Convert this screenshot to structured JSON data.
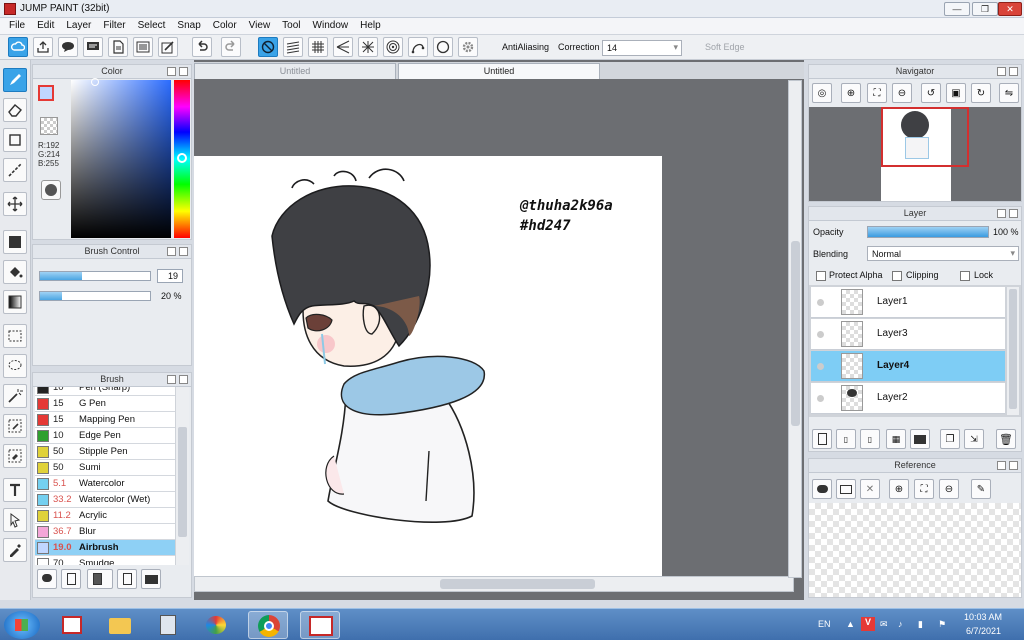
{
  "window": {
    "title": "JUMP PAINT (32bit)",
    "min": "—",
    "max": "❐",
    "close": "✕"
  },
  "menu": [
    "File",
    "Edit",
    "Layer",
    "Filter",
    "Select",
    "Snap",
    "Color",
    "View",
    "Tool",
    "Window",
    "Help"
  ],
  "toolbar": {
    "antialias_label": "AntiAliasing",
    "correction_label": "Correction",
    "correction_value": "14",
    "soft_edge_label": "Soft Edge",
    "antialias_checked": true,
    "soft_edge_checked": false
  },
  "color_panel": {
    "title": "Color",
    "r": "R:192",
    "g": "G:214",
    "b": "B:255",
    "fg_color": "#c0d6ff"
  },
  "brush_control": {
    "title": "Brush Control",
    "size_value": "19",
    "opacity_value": "20 %",
    "size_fraction": 0.38,
    "opacity_fraction": 0.2
  },
  "brush_panel": {
    "title": "Brush",
    "items": [
      {
        "size": "10",
        "name": "Pen (Sharp)",
        "color": "#222222"
      },
      {
        "size": "15",
        "name": "G Pen",
        "color": "#e53935"
      },
      {
        "size": "15",
        "name": "Mapping Pen",
        "color": "#e53935"
      },
      {
        "size": "10",
        "name": "Edge Pen",
        "color": "#2ea02e"
      },
      {
        "size": "50",
        "name": "Stipple Pen",
        "color": "#e0d23a"
      },
      {
        "size": "50",
        "name": "Sumi",
        "color": "#e0d23a"
      },
      {
        "size": "5.1",
        "name": "Watercolor",
        "color": "#74d0f0"
      },
      {
        "size": "33.2",
        "name": "Watercolor (Wet)",
        "color": "#74d0f0"
      },
      {
        "size": "11.2",
        "name": "Acrylic",
        "color": "#e0d23a"
      },
      {
        "size": "36.7",
        "name": "Blur",
        "color": "#f4a6d8"
      },
      {
        "size": "19.0",
        "name": "Airbrush",
        "color": "#c0d6ff"
      },
      {
        "size": "70",
        "name": "Smudge",
        "color": "#ffffff"
      }
    ],
    "selected_index": 10
  },
  "tabs": [
    "Untitled",
    "Untitled"
  ],
  "canvas": {
    "watermark_line1": "@thuha2k96a",
    "watermark_line2": "#hd247"
  },
  "navigator": {
    "title": "Navigator"
  },
  "layer_panel": {
    "title": "Layer",
    "opacity_label": "Opacity",
    "opacity_value": "100 %",
    "blending_label": "Blending",
    "blending_value": "Normal",
    "protect_alpha": "Protect Alpha",
    "clipping": "Clipping",
    "lock": "Lock",
    "layers": [
      "Layer1",
      "Layer3",
      "Layer4",
      "Layer2"
    ],
    "selected_index": 2
  },
  "reference": {
    "title": "Reference"
  },
  "taskbar": {
    "lang": "EN",
    "time": "10:03 AM",
    "date": "6/7/2021"
  },
  "icons": [
    "cloud-icon",
    "share-icon",
    "speech-icon",
    "message-icon",
    "doc-icon",
    "list-icon",
    "stamp-icon",
    "undo-icon",
    "redo-icon",
    "no-snap-icon",
    "parallel-icon",
    "grid-icon",
    "radial-icon",
    "burst-icon",
    "concentric-icon",
    "curve-icon",
    "circle-icon",
    "gear-icon"
  ]
}
